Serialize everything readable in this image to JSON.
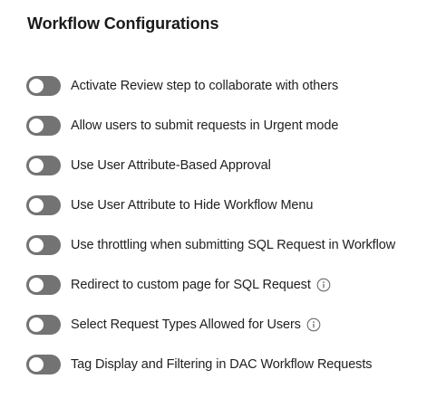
{
  "header": {
    "title": "Workflow Configurations"
  },
  "settings": [
    {
      "label": "Activate Review step to collaborate with others",
      "enabled": false,
      "info": false
    },
    {
      "label": "Allow users to submit requests in Urgent mode",
      "enabled": false,
      "info": false
    },
    {
      "label": "Use User Attribute-Based Approval",
      "enabled": false,
      "info": false
    },
    {
      "label": "Use User Attribute to Hide Workflow Menu",
      "enabled": false,
      "info": false
    },
    {
      "label": "Use throttling when submitting SQL Request in Workflow",
      "enabled": false,
      "info": false
    },
    {
      "label": "Redirect to custom page for SQL Request",
      "enabled": false,
      "info": true
    },
    {
      "label": "Select Request Types Allowed for Users",
      "enabled": false,
      "info": true
    },
    {
      "label": "Tag Display and Filtering in DAC Workflow Requests",
      "enabled": false,
      "info": false
    }
  ],
  "colors": {
    "toggle_off": "#737373",
    "knob": "#ffffff",
    "text": "#1f1f1f",
    "info_icon": "#6b6b6b"
  },
  "icons": {
    "info": "info-circle-icon"
  }
}
